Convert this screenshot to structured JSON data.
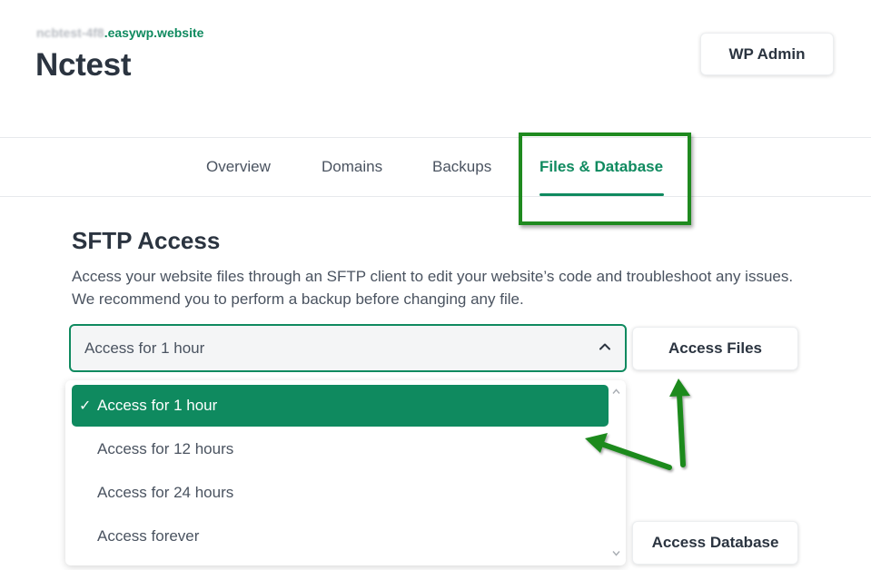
{
  "header": {
    "site_url_prefix": "ncbtest-4f8",
    "site_url_suffix": ".easywp.website",
    "site_title": "Nctest",
    "wp_admin_label": "WP Admin"
  },
  "tabs": [
    {
      "label": "Overview"
    },
    {
      "label": "Domains"
    },
    {
      "label": "Backups"
    },
    {
      "label": "Files & Database",
      "active": true
    }
  ],
  "sftp": {
    "title": "SFTP Access",
    "description": "Access your website files through an SFTP client to edit your website’s code and troubleshoot any issues. We recommend you to perform a backup before changing any file.",
    "selected_value": "Access for 1 hour",
    "options": [
      "Access for 1 hour",
      "Access for 12 hours",
      "Access for 24 hours",
      "Access forever"
    ],
    "access_files_label": "Access Files",
    "access_database_label": "Access Database"
  },
  "colors": {
    "brand_green": "#0f8a5f",
    "annotation_green": "#1f8a1f",
    "text_dark": "#2b3440"
  },
  "icons": {
    "select_chevron": "chevron-up-icon",
    "selected_check": "check-icon"
  }
}
